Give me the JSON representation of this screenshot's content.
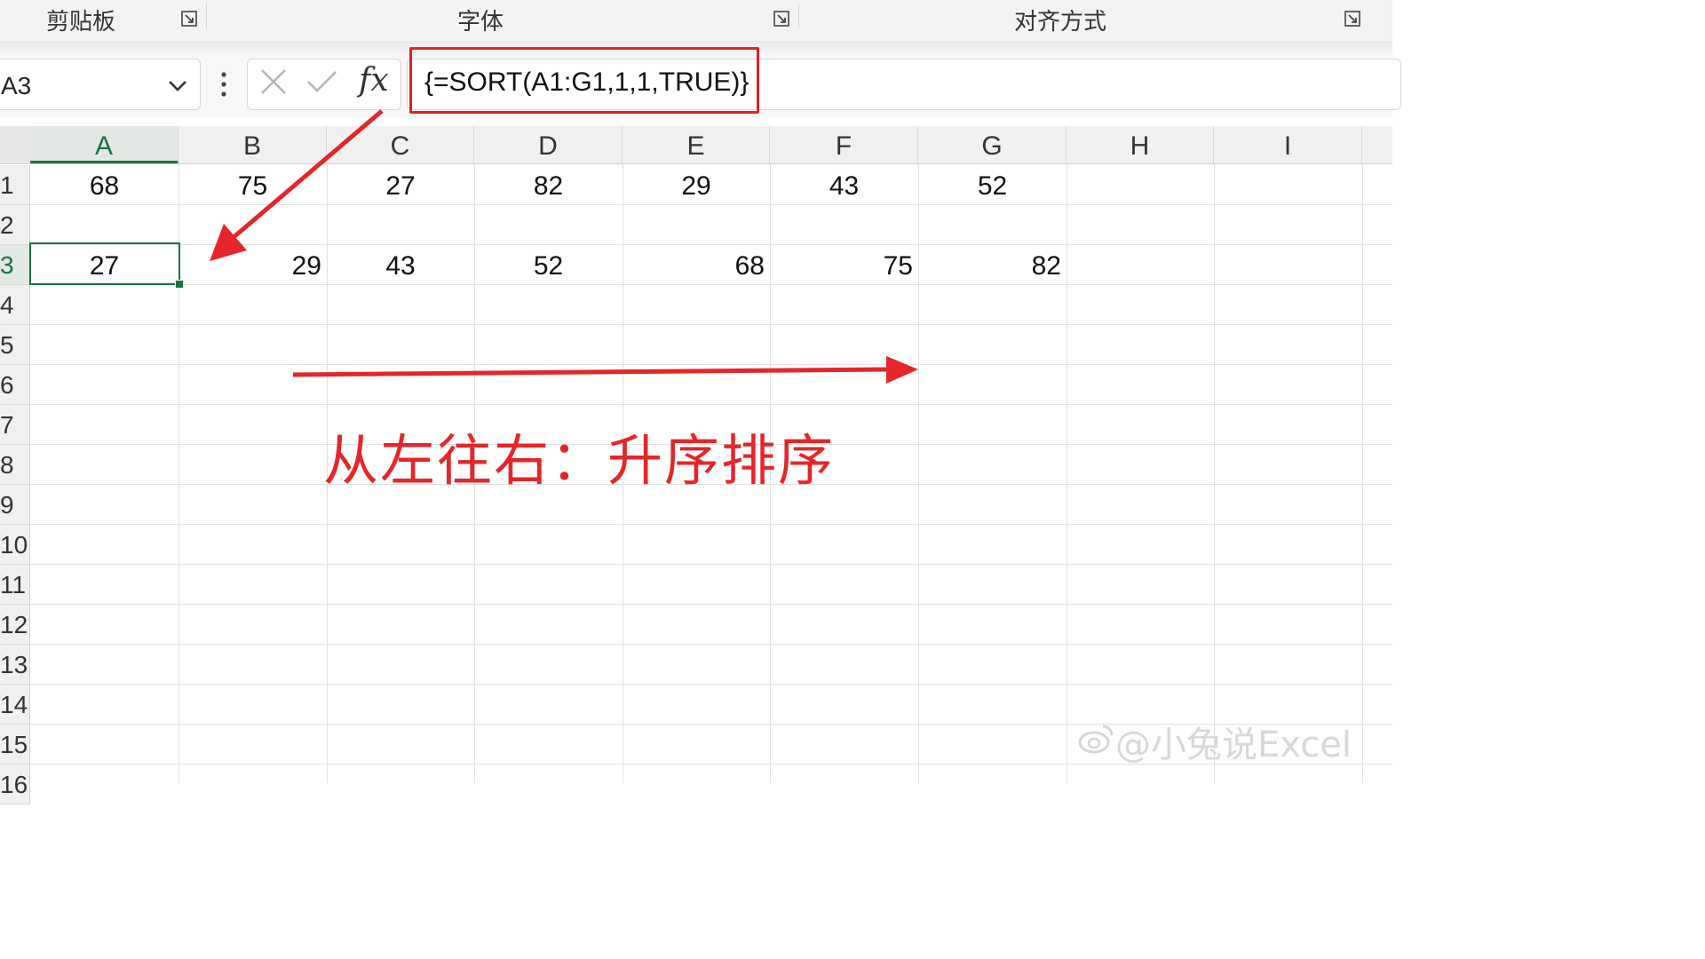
{
  "ribbon": {
    "groups": [
      {
        "label": "剪贴板"
      },
      {
        "label": "字体"
      },
      {
        "label": "对齐方式"
      }
    ],
    "launcher_icon": "dialog-launcher-icon"
  },
  "formula_bar": {
    "name_box": "A3",
    "fx_label": "fx",
    "formula": "{=SORT(A1:G1,1,1,TRUE)}"
  },
  "grid": {
    "columns": [
      "A",
      "B",
      "C",
      "D",
      "E",
      "F",
      "G",
      "H",
      "I"
    ],
    "rows": [
      "1",
      "2",
      "3",
      "4",
      "5",
      "6",
      "7",
      "8",
      "9",
      "10",
      "11",
      "12",
      "13",
      "14",
      "15",
      "16"
    ],
    "row1": [
      "68",
      "75",
      "27",
      "82",
      "29",
      "43",
      "52"
    ],
    "row3": [
      "27",
      "29",
      "43",
      "52",
      "68",
      "75",
      "82"
    ],
    "active_cell": "A3"
  },
  "annotation": {
    "text": "从左往右：升序排序",
    "color": "#e4262a"
  },
  "watermark": "@小兔说Excel",
  "colors": {
    "selection": "#1e7145",
    "highlight": "#e02020"
  }
}
